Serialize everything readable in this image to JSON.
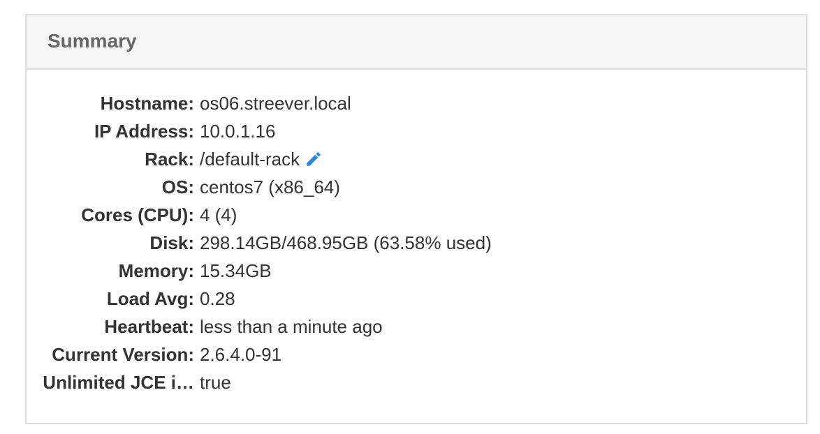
{
  "summary": {
    "title": "Summary",
    "rows": [
      {
        "label": "Hostname:",
        "value": "os06.streever.local"
      },
      {
        "label": "IP Address:",
        "value": "10.0.1.16"
      },
      {
        "label": "Rack:",
        "value": "/default-rack",
        "edit_icon": "pencil-icon"
      },
      {
        "label": "OS:",
        "value": "centos7 (x86_64)"
      },
      {
        "label": "Cores (CPU):",
        "value": "4 (4)"
      },
      {
        "label": "Disk:",
        "value": "298.14GB/468.95GB (63.58% used)"
      },
      {
        "label": "Memory:",
        "value": "15.34GB"
      },
      {
        "label": "Load Avg:",
        "value": "0.28"
      },
      {
        "label": "Heartbeat:",
        "value": "less than a minute ago"
      },
      {
        "label": "Current Version:",
        "value": "2.6.4.0-91"
      },
      {
        "label": "Unlimited JCE i…",
        "value": "true"
      }
    ]
  },
  "colors": {
    "accent": "#2f86d6",
    "header_bg": "#f5f5f5",
    "border": "#dcdcdc"
  }
}
